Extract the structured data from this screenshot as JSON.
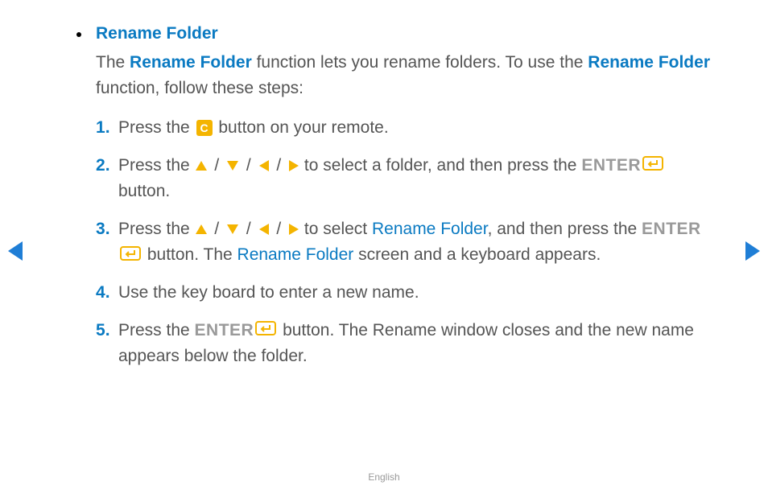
{
  "section": {
    "title": "Rename Folder",
    "intro_parts": {
      "t1": "The ",
      "rf1": "Rename Folder",
      "t2": " function lets you rename folders. To use the ",
      "rf2": "Rename Folder",
      "t3": " function, follow these steps:"
    }
  },
  "steps": {
    "s1": {
      "a": "Press the ",
      "c_label": "C",
      "b": " button on your remote."
    },
    "s2": {
      "a": "Press the ",
      "b": " to select a folder, and then press the ",
      "enter": "ENTER",
      "c": " button."
    },
    "s3": {
      "a": "Press the ",
      "b": " to select ",
      "rf": "Rename Folder",
      "c": ", and then press the ",
      "enter": "ENTER",
      "d": " button. The ",
      "rf2": "Rename Folder",
      "e": " screen and a keyboard appears."
    },
    "s4": {
      "a": "Use the key board to enter a new name."
    },
    "s5": {
      "a": "Press the ",
      "enter": "ENTER",
      "b": " button. The Rename window closes and the new name appears below the folder."
    }
  },
  "slash": " / ",
  "footer": {
    "lang": "English"
  }
}
